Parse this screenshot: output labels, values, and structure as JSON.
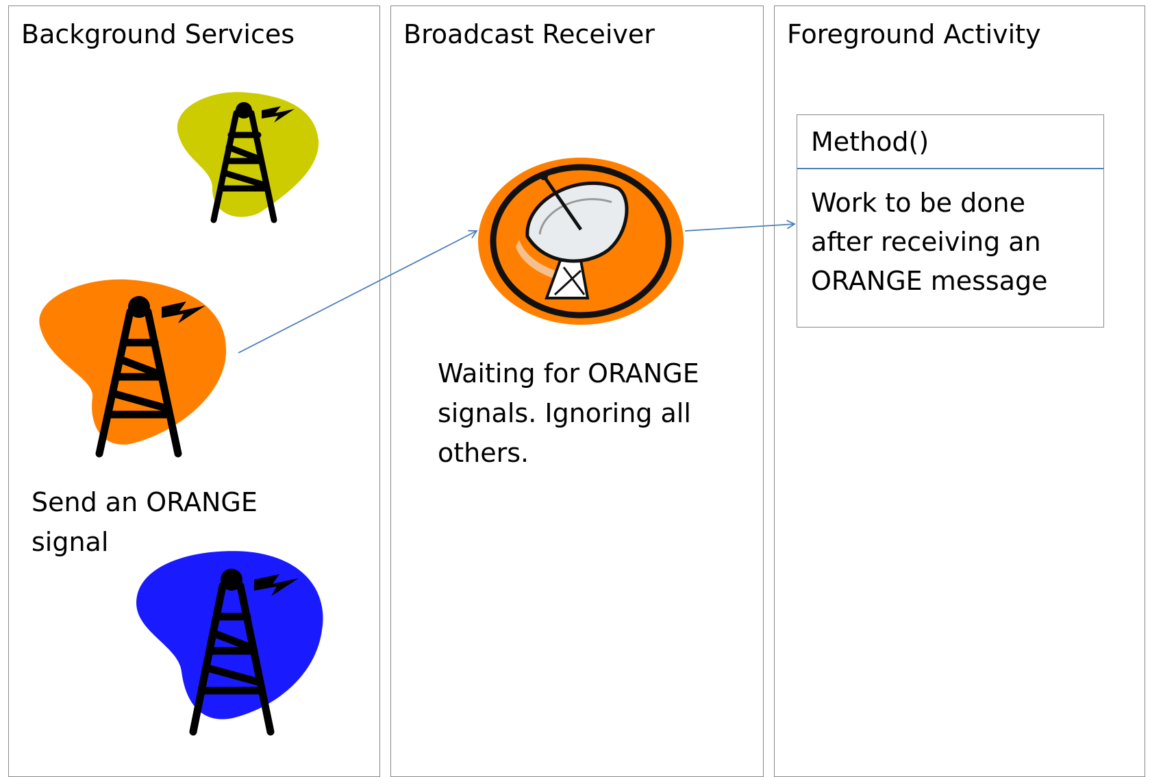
{
  "panels": [
    {
      "title": "Background Services"
    },
    {
      "title": "Broadcast Receiver"
    },
    {
      "title": "Foreground Activity"
    }
  ],
  "sender": {
    "caption_lines": [
      "Send an ORANGE",
      "signal"
    ]
  },
  "receiver": {
    "caption_lines": [
      "Waiting for ORANGE",
      "signals. Ignoring all",
      "others."
    ]
  },
  "method_box": {
    "header": "Method()",
    "body_lines": [
      "Work to be done",
      "after receiving an",
      "ORANGE message"
    ]
  },
  "colors": {
    "tower_yellow": "#cccc00",
    "tower_orange": "#ff8000",
    "tower_blue": "#1a1aff",
    "dish_orange": "#ff8000",
    "arrow": "#4a7ebb",
    "border": "#888888"
  },
  "icons": [
    "radio-tower-icon",
    "radio-tower-icon",
    "radio-tower-icon",
    "satellite-dish-icon"
  ]
}
